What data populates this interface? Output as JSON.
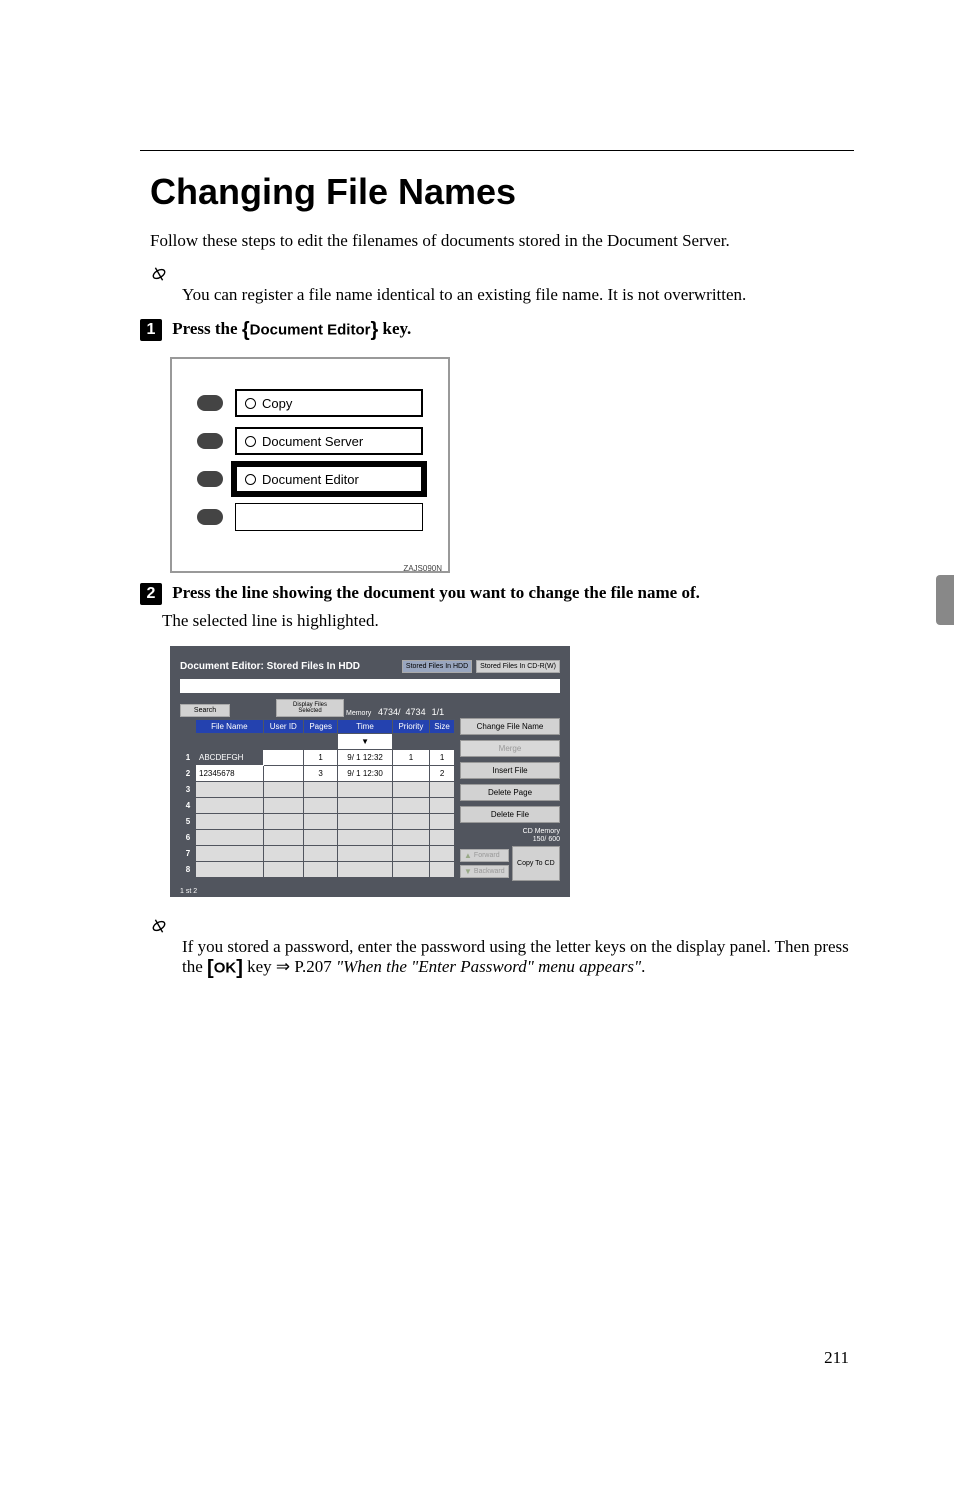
{
  "title": "Changing File Names",
  "intro": "Follow these steps to edit the filenames of documents stored in the Document Server.",
  "note1": "You can register a file name identical to an existing file name. It is not overwritten.",
  "step1": {
    "num": "1",
    "prefix": "Press the ",
    "keyname": "Document Editor",
    "suffix": " key."
  },
  "fig1": {
    "rows": [
      "Copy",
      "Document Server",
      "Document Editor",
      ""
    ],
    "selected_index": 2,
    "code": "ZAJS090N"
  },
  "step2": {
    "num": "2",
    "bold": "Press the line showing the document you want to change the file name of.",
    "desc": "The selected line is highlighted."
  },
  "fig2": {
    "title": "Document Editor: Stored Files In HDD",
    "tabs": [
      "Stored Files In HDD",
      "Stored Files In CD-R(W)"
    ],
    "search_btn": "Search",
    "display_btn": "Display Files Selected",
    "memory_label": "Memory",
    "memory_vals": [
      "4734/",
      "4734"
    ],
    "page_ind": "1/1",
    "headers": [
      "",
      "File Name",
      "User ID",
      "Pages",
      "Time",
      "Priority",
      "Size"
    ],
    "rows": [
      {
        "idx": "1",
        "name": "ABCDEFGH",
        "user": "",
        "pages": "1",
        "time": "9/ 1 12:32",
        "priority": "1",
        "size": "1",
        "selected": true
      },
      {
        "idx": "2",
        "name": "12345678",
        "user": "",
        "pages": "3",
        "time": "9/ 1 12:30",
        "priority": "",
        "size": "2"
      },
      {
        "idx": "3"
      },
      {
        "idx": "4"
      },
      {
        "idx": "5"
      },
      {
        "idx": "6"
      },
      {
        "idx": "7"
      },
      {
        "idx": "8"
      }
    ],
    "actions": {
      "change_name": "Change File Name",
      "merge": "Merge",
      "insert_file": "Insert File",
      "delete_page": "Delete Page",
      "delete_file": "Delete File",
      "cd_memory": "CD Memory",
      "cd_memory_vals": "150/    600",
      "forward": "Forward",
      "backward": "Backward",
      "copy_cd": "Copy To CD"
    },
    "mini_label": "1 st\n2"
  },
  "note2": {
    "l1_a": "If you stored a password, enter the password using the letter keys on the display panel. Then press the ",
    "l1_key": "OK",
    "l1_b": " key ",
    "l1_arrow": "⇒",
    "l1_c": "P.207 ",
    "italic": "\"When the \"Enter Password\" menu appears\"",
    "period": "."
  },
  "page_number": "211"
}
